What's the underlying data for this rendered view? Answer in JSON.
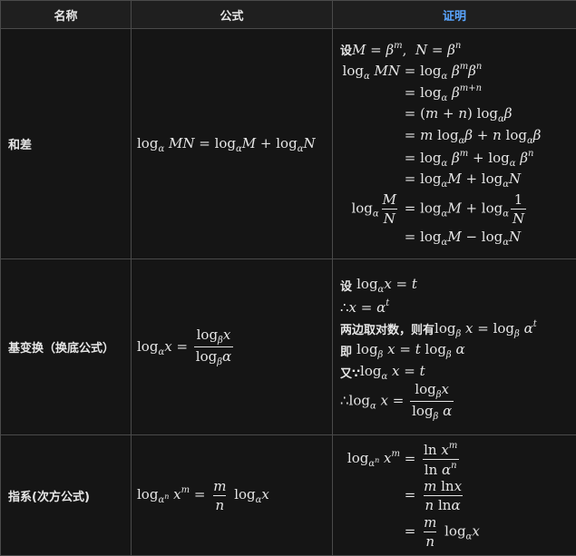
{
  "headers": {
    "name": "名称",
    "formula": "公式",
    "proof": "证明"
  },
  "rows": [
    {
      "name": "和差",
      "formula": "log_α MN = log_α M + log_α N",
      "proof": {
        "set": "设",
        "set_expr": "M = β^m, N = β^n",
        "steps": [
          "log_α MN = log_α β^m β^n",
          "= log_α β^(m+n)",
          "= (m+n) log_α β",
          "= m log_α β + n log_α β",
          "= log_α β^m + log_α β^n",
          "= log_α M + log_α N",
          "log_α M/N = log_α M + log_α 1/N",
          "= log_α M − log_α N"
        ]
      }
    },
    {
      "name": "基变换（换底公式）",
      "formula": "log_α x = log_β x / log_β α",
      "proof": {
        "l1_text": "设",
        "l2_text": "∴",
        "l3_text": "两边取对数，则有",
        "l4_text": "即",
        "l5_text": "又∵",
        "l6_text": "∴"
      }
    },
    {
      "name": "指系(次方公式)",
      "formula": "log_(α^n) x^m = m/n log_α x",
      "proof": {
        "steps": [
          "log_(α^n) x^m = ln x^m / ln α^n",
          "= m ln x / n ln α",
          "= m/n log_α x"
        ]
      }
    }
  ]
}
